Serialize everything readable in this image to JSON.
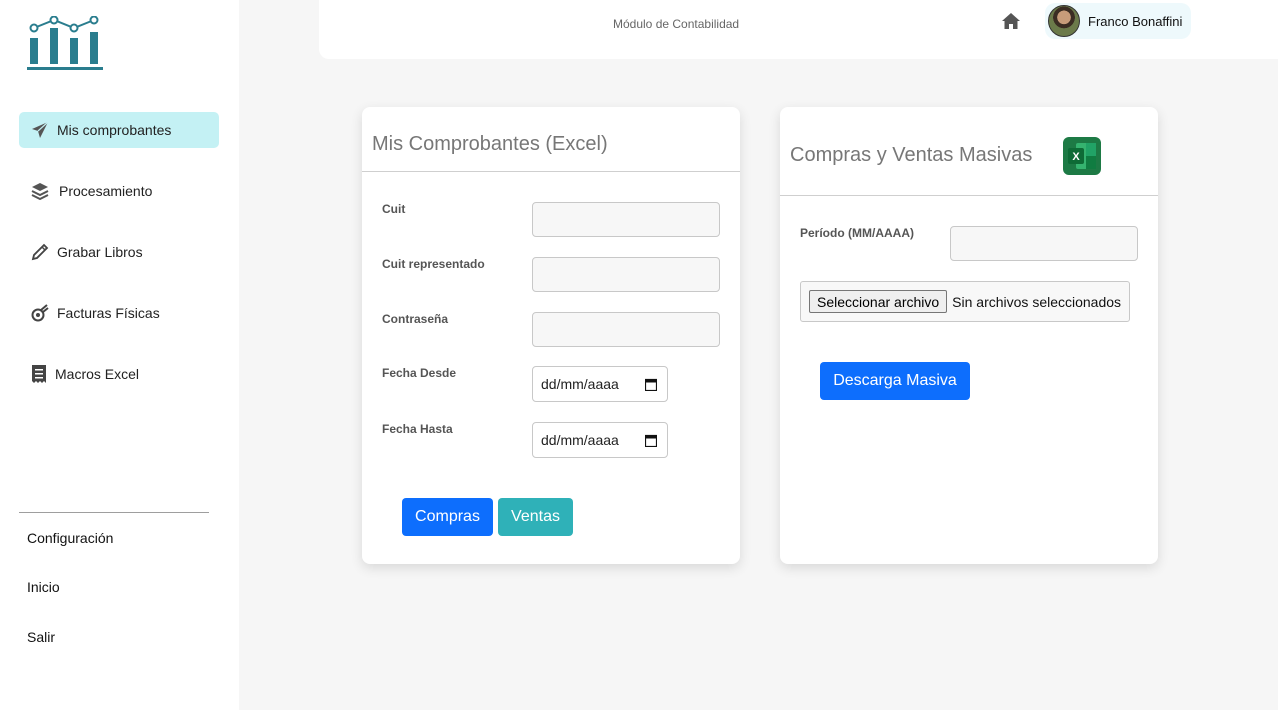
{
  "sidebar": {
    "logo_icon": "bar-chart-logo-icon",
    "items": [
      {
        "label": "Mis comprobantes",
        "icon": "paper-plane-icon"
      },
      {
        "label": "Procesamiento",
        "icon": "layers-icon"
      },
      {
        "label": "Grabar Libros",
        "icon": "pencil-icon"
      },
      {
        "label": "Facturas Físicas",
        "icon": "comet-icon"
      },
      {
        "label": "Macros Excel",
        "icon": "receipt-icon"
      }
    ],
    "bottom_links": [
      "Configuración",
      "Inicio",
      "Salir"
    ],
    "active_color": "#c4f1f4"
  },
  "header": {
    "module_title": "Módulo de Contabilidad",
    "user_name": "Franco Bonaffini"
  },
  "left_card": {
    "title": "Mis Comprobantes (Excel)",
    "fields": {
      "cuit": {
        "label": "Cuit",
        "value": ""
      },
      "cuit_rep": {
        "label": "Cuit representado",
        "value": ""
      },
      "password": {
        "label": "Contraseña",
        "value": ""
      },
      "fecha_desde": {
        "label": "Fecha Desde",
        "value": "dd/mm/aaaa"
      },
      "fecha_hasta": {
        "label": "Fecha Hasta",
        "value": "dd/mm/aaaa"
      }
    },
    "buttons": {
      "compras": "Compras",
      "ventas": "Ventas"
    }
  },
  "right_card": {
    "title": "Compras y Ventas Masivas",
    "period_label": "Período (MM/AAAA)",
    "period_value": "",
    "file_button": "Seleccionar archivo",
    "file_status": "Sin archivos seleccionados",
    "download_button": "Descarga Masiva"
  },
  "colors": {
    "primary": "#0d6efd",
    "teal": "#2fb1b8",
    "brand": "#2a7d8e"
  }
}
